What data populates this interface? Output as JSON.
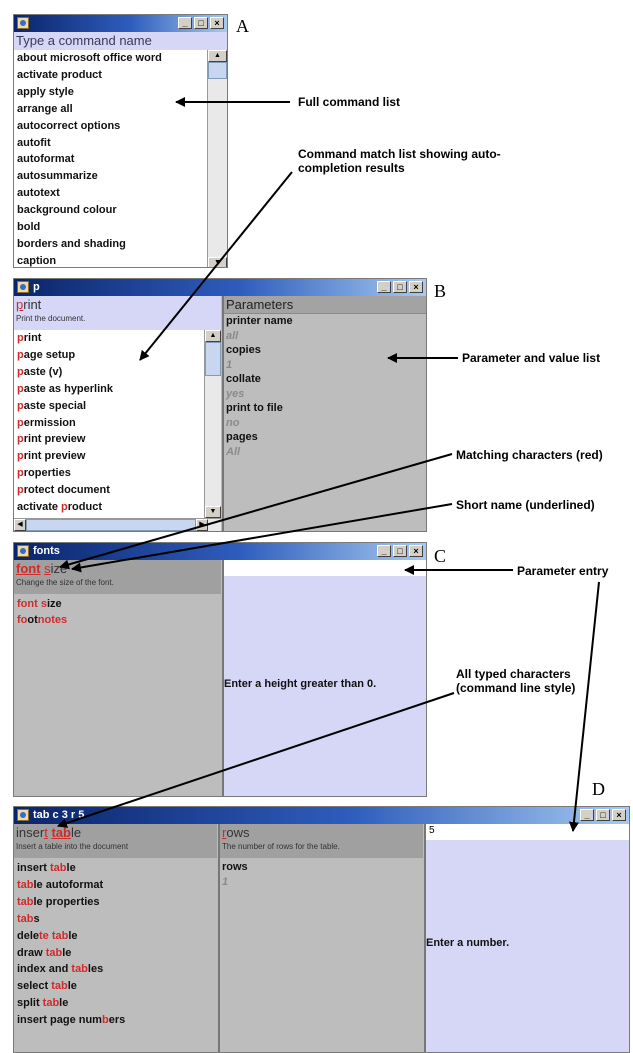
{
  "labels": {
    "a": "A",
    "b": "B",
    "c": "C",
    "d": "D"
  },
  "window_controls": {
    "minimize": "_",
    "maximize": "□",
    "close": "×"
  },
  "win_a": {
    "title": "",
    "placeholder": "Type a command name",
    "commands": [
      "about microsoft office word",
      "activate product",
      "apply style",
      "arrange all",
      "autocorrect options",
      "autofit",
      "autoformat",
      "autosummarize",
      "autotext",
      "background colour",
      "bold",
      "borders and shading",
      "caption"
    ]
  },
  "win_b": {
    "title": "p",
    "selected": {
      "first": "p",
      "rest": "rint"
    },
    "description": "Print the document.",
    "matches": [
      {
        "pre": "",
        "hl": "p",
        "post": "rint"
      },
      {
        "pre": "",
        "hl": "p",
        "post": "age setup"
      },
      {
        "pre": "",
        "hl": "p",
        "post": "aste (v)"
      },
      {
        "pre": "",
        "hl": "p",
        "post": "aste as hyperlink"
      },
      {
        "pre": "",
        "hl": "p",
        "post": "aste special"
      },
      {
        "pre": "",
        "hl": "p",
        "post": "ermission"
      },
      {
        "pre": "",
        "hl": "p",
        "post": "rint preview"
      },
      {
        "pre": "",
        "hl": "p",
        "post": "rint preview"
      },
      {
        "pre": "",
        "hl": "p",
        "post": "roperties"
      },
      {
        "pre": "",
        "hl": "p",
        "post": "rotect document"
      },
      {
        "pre": "activate ",
        "hl": "p",
        "post": "roduct"
      }
    ],
    "params_header": "Parameters",
    "params": [
      {
        "name": "printer name",
        "value": "all"
      },
      {
        "name": "copies",
        "value": "1"
      },
      {
        "name": "collate",
        "value": "yes"
      },
      {
        "name": "print to file",
        "value": "no"
      },
      {
        "name": "pages",
        "value": "All"
      }
    ]
  },
  "win_c": {
    "title": "fonts",
    "selected": {
      "part1": "font",
      "space": " ",
      "part2": "s",
      "part3": "ize"
    },
    "description": "Change the size of the font.",
    "matches": [
      {
        "a": "font s",
        "b": "ize",
        "c": "",
        "d": ""
      },
      {
        "a": "fo",
        "b": "ot",
        "c": "n",
        "d": "otes"
      }
    ],
    "message": "Enter a height greater than 0."
  },
  "win_d": {
    "title": "tab c 3 r 5",
    "selected": {
      "p1": "inser",
      "p2": "t",
      "p3": " ",
      "p4": "tab",
      "p5": "le"
    },
    "description": "Insert a table into the document",
    "matches": [
      {
        "pre": "insert ",
        "hl": "tab",
        "post": "le"
      },
      {
        "pre": "",
        "hl": "tab",
        "post": "le autoformat"
      },
      {
        "pre": "",
        "hl": "tab",
        "post": "le properties"
      },
      {
        "pre": "",
        "hl": "tab",
        "post": "s"
      },
      {
        "pre": "dele",
        "hl": "te tab",
        "post": "le"
      },
      {
        "pre": "draw ",
        "hl": "tab",
        "post": "le"
      },
      {
        "pre": "index and ",
        "hl": "tab",
        "post": "les"
      },
      {
        "pre": "select ",
        "hl": "tab",
        "post": "le"
      },
      {
        "pre": "split ",
        "hl": "tab",
        "post": "le"
      },
      {
        "pre": "insert page num",
        "hl": "b",
        "post": "ers"
      }
    ],
    "param_selected": {
      "first": "r",
      "rest": "ows"
    },
    "param_description": "The number of rows for the table.",
    "param_name": "rows",
    "param_value": "1",
    "entry_value": "5",
    "message": "Enter a number."
  },
  "annotations": {
    "full_list": "Full command list",
    "match_list": "Command match list showing auto-completion results",
    "param_list": "Parameter and value list",
    "matching_chars": "Matching characters (red)",
    "short_name": "Short name (underlined)",
    "param_entry": "Parameter entry",
    "typed_chars": "All typed characters (command line style)"
  }
}
